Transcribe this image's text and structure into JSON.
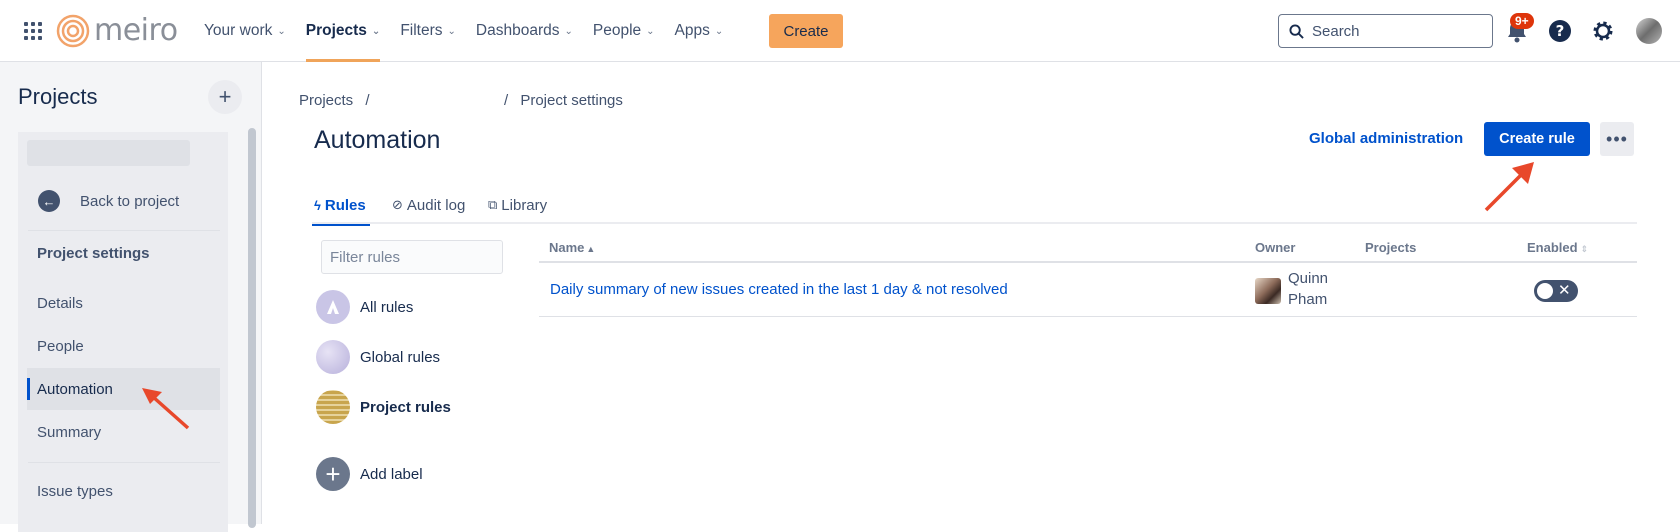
{
  "topbar": {
    "logo_text": "meiro",
    "nav": [
      {
        "label": "Your work",
        "active": false
      },
      {
        "label": "Projects",
        "active": true
      },
      {
        "label": "Filters",
        "active": false
      },
      {
        "label": "Dashboards",
        "active": false
      },
      {
        "label": "People",
        "active": false
      },
      {
        "label": "Apps",
        "active": false
      }
    ],
    "create_label": "Create",
    "search_placeholder": "Search",
    "notification_badge": "9+",
    "accent_color": "#f6a55c"
  },
  "sidebar": {
    "title": "Projects",
    "add_label": "+",
    "back_label": "Back to project",
    "section_heading": "Project settings",
    "items": [
      {
        "label": "Details",
        "active": false
      },
      {
        "label": "People",
        "active": false
      },
      {
        "label": "Automation",
        "active": true
      },
      {
        "label": "Summary",
        "active": false
      },
      {
        "label": "Issue types",
        "active": false
      }
    ]
  },
  "main": {
    "breadcrumb_root": "Projects",
    "breadcrumb_sep": "/",
    "breadcrumb_current": "Project settings",
    "title": "Automation",
    "global_admin_label": "Global administration",
    "create_rule_label": "Create rule",
    "more_label": "•••",
    "tabs": [
      {
        "label": "Rules",
        "icon": "bolt-icon",
        "active": true
      },
      {
        "label": "Audit log",
        "icon": "check-circle-icon",
        "active": false
      },
      {
        "label": "Library",
        "icon": "copy-icon",
        "active": false
      }
    ],
    "filter_placeholder": "Filter rules",
    "categories": [
      {
        "label": "All rules",
        "bold": false
      },
      {
        "label": "Global rules",
        "bold": false
      },
      {
        "label": "Project rules",
        "bold": true
      },
      {
        "label": "Add label",
        "bold": false
      }
    ],
    "table": {
      "headers": {
        "name": "Name",
        "owner": "Owner",
        "projects": "Projects",
        "enabled": "Enabled"
      },
      "rows": [
        {
          "name": "Daily summary of new issues created in the last 1 day & not resolved",
          "owner": "Quinn Pham",
          "enabled": false
        }
      ]
    },
    "primary_color": "#0052cc"
  }
}
